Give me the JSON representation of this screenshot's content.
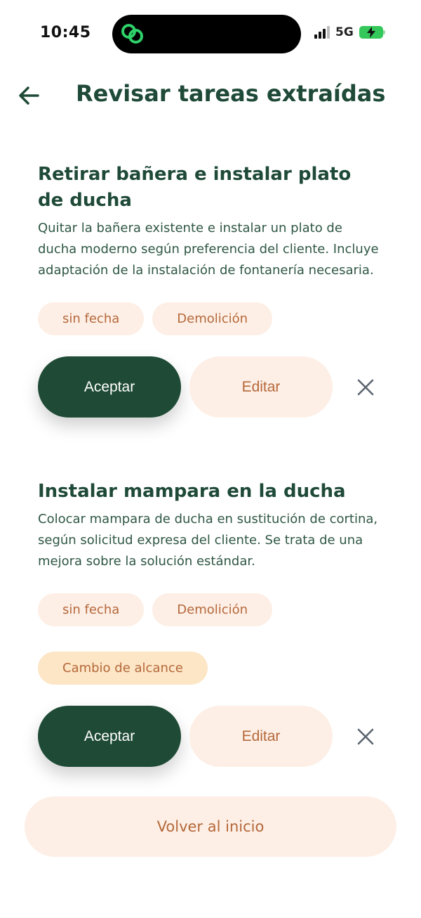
{
  "status": {
    "time": "10:45",
    "network": "5G"
  },
  "header": {
    "title": "Revisar tareas extraídas"
  },
  "tasks": [
    {
      "title": "Retirar bañera e instalar plato de ducha",
      "description": "Quitar la bañera existente e instalar un plato de ducha moderno según preferencia del cliente. Incluye adaptación de la instalación de fontanería necesaria.",
      "chips": [
        "sin fecha",
        "Demolición"
      ],
      "accept_label": "Aceptar",
      "edit_label": "Editar"
    },
    {
      "title": "Instalar mampara en la ducha",
      "description": "Colocar mampara de ducha en sustitución de cortina, según solicitud expresa del cliente. Se trata de una mejora sobre la solución estándar.",
      "chips": [
        "sin fecha",
        "Demolición"
      ],
      "scope_chip": "Cambio de alcance",
      "accept_label": "Aceptar",
      "edit_label": "Editar"
    }
  ],
  "footer": {
    "home_label": "Volver al inicio"
  },
  "colors": {
    "primary": "#1e4a36",
    "chip_bg": "#fdefe6",
    "chip_text": "#b5683a",
    "scope_chip_bg": "#fde6c6"
  },
  "icons": [
    "back-arrow-icon",
    "close-icon",
    "battery-charging-icon",
    "signal-icon",
    "app-link-icon"
  ]
}
